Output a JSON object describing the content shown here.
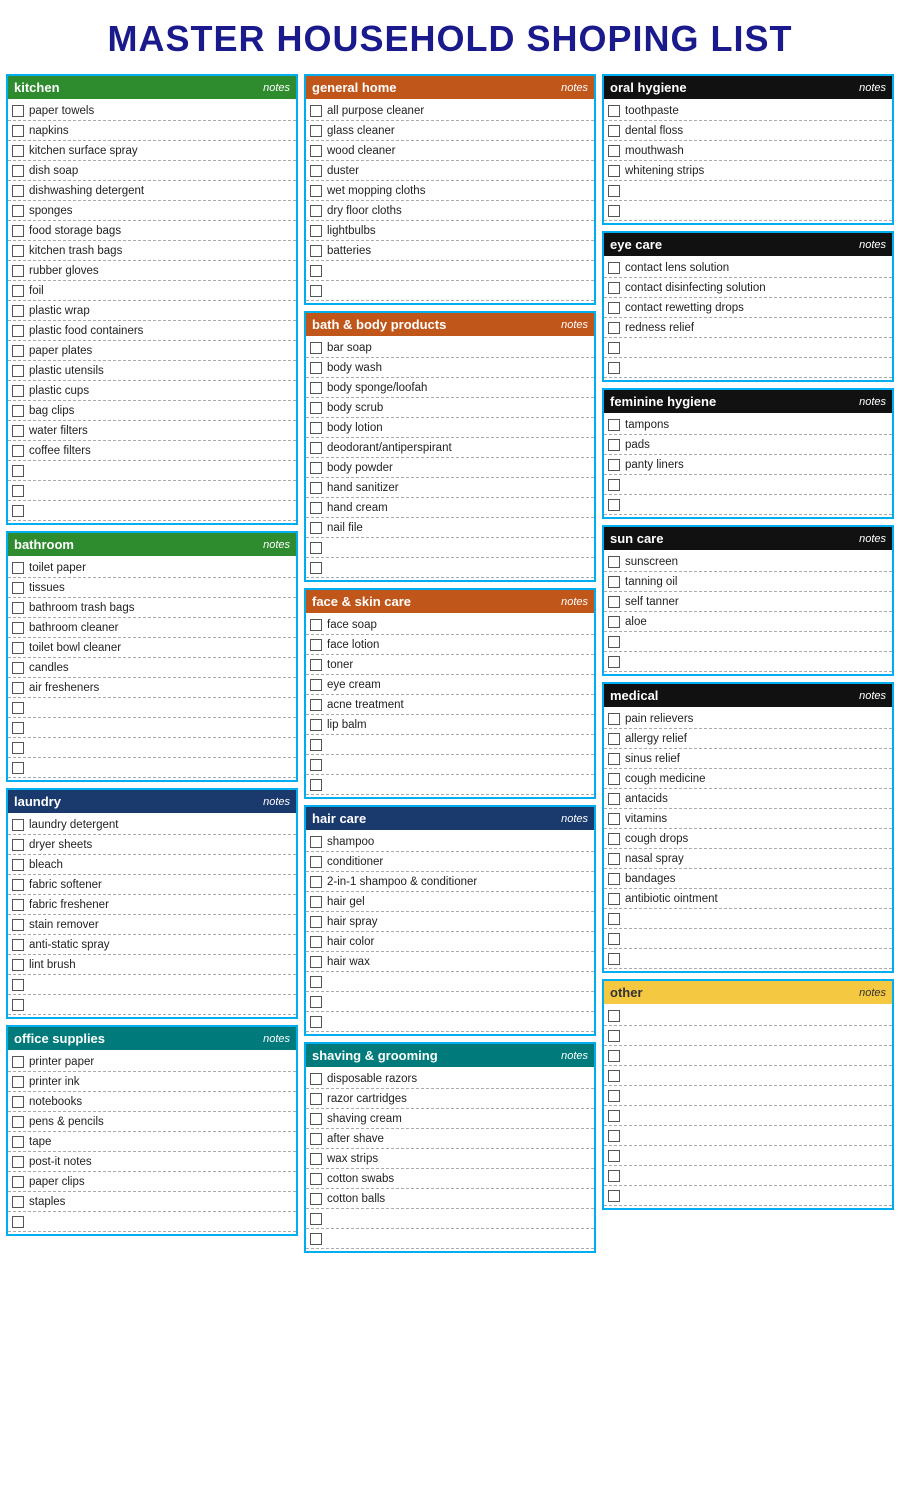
{
  "title": "MASTER HOUSEHOLD SHOPING LIST",
  "sections": {
    "kitchen": {
      "label": "kitchen",
      "headerClass": "green",
      "items": [
        "paper towels",
        "napkins",
        "kitchen surface spray",
        "dish soap",
        "dishwashing detergent",
        "sponges",
        "food storage bags",
        "kitchen trash bags",
        "rubber gloves",
        "foil",
        "plastic wrap",
        "plastic food containers",
        "paper plates",
        "plastic utensils",
        "plastic cups",
        "bag clips",
        "water filters",
        "coffee filters"
      ],
      "emptyRows": 3
    },
    "bathroom": {
      "label": "bathroom",
      "headerClass": "green",
      "items": [
        "toilet paper",
        "tissues",
        "bathroom trash bags",
        "bathroom cleaner",
        "toilet bowl cleaner",
        "candles",
        "air fresheners"
      ],
      "emptyRows": 4
    },
    "laundry": {
      "label": "laundry",
      "headerClass": "navy",
      "items": [
        "laundry detergent",
        "dryer sheets",
        "bleach",
        "fabric softener",
        "fabric freshener",
        "stain remover",
        "anti-static spray",
        "lint brush"
      ],
      "emptyRows": 2
    },
    "office_supplies": {
      "label": "office supplies",
      "headerClass": "teal",
      "items": [
        "printer paper",
        "printer ink",
        "notebooks",
        "pens & pencils",
        "tape",
        "post-it notes",
        "paper clips",
        "staples"
      ],
      "emptyRows": 1
    },
    "general_home": {
      "label": "general home",
      "headerClass": "orange",
      "items": [
        "all purpose cleaner",
        "glass cleaner",
        "wood cleaner",
        "duster",
        "wet mopping cloths",
        "dry floor cloths",
        "lightbulbs",
        "batteries"
      ],
      "emptyRows": 2
    },
    "bath_body": {
      "label": "bath & body products",
      "headerClass": "orange",
      "items": [
        "bar soap",
        "body wash",
        "body sponge/loofah",
        "body scrub",
        "body lotion",
        "deodorant/antiperspirant",
        "body powder",
        "hand sanitizer",
        "hand cream",
        "nail file"
      ],
      "emptyRows": 2
    },
    "face_skin": {
      "label": "face & skin care",
      "headerClass": "orange",
      "items": [
        "face soap",
        "face lotion",
        "toner",
        "eye cream",
        "acne treatment",
        "lip balm"
      ],
      "emptyRows": 3
    },
    "hair_care": {
      "label": "hair care",
      "headerClass": "navy",
      "items": [
        "shampoo",
        "conditioner",
        "2-in-1 shampoo & conditioner",
        "hair gel",
        "hair spray",
        "hair color",
        "hair wax"
      ],
      "emptyRows": 3
    },
    "shaving_grooming": {
      "label": "shaving & grooming",
      "headerClass": "teal",
      "items": [
        "disposable razors",
        "razor cartridges",
        "shaving cream",
        "after shave",
        "wax strips",
        "cotton swabs",
        "cotton balls"
      ],
      "emptyRows": 2
    },
    "oral_hygiene": {
      "label": "oral hygiene",
      "headerClass": "black",
      "items": [
        "toothpaste",
        "dental floss",
        "mouthwash",
        "whitening strips"
      ],
      "emptyRows": 2
    },
    "eye_care": {
      "label": "eye care",
      "headerClass": "black",
      "items": [
        "contact lens solution",
        "contact disinfecting solution",
        "contact rewetting drops",
        "redness relief"
      ],
      "emptyRows": 2
    },
    "feminine_hygiene": {
      "label": "feminine hygiene",
      "headerClass": "black",
      "items": [
        "tampons",
        "pads",
        "panty liners"
      ],
      "emptyRows": 2
    },
    "sun_care": {
      "label": "sun care",
      "headerClass": "black",
      "items": [
        "sunscreen",
        "tanning oil",
        "self tanner",
        "aloe"
      ],
      "emptyRows": 2
    },
    "medical": {
      "label": "medical",
      "headerClass": "black",
      "items": [
        "pain relievers",
        "allergy relief",
        "sinus relief",
        "cough medicine",
        "antacids",
        "vitamins",
        "cough drops",
        "nasal spray",
        "bandages",
        "antibiotic ointment"
      ],
      "emptyRows": 3
    },
    "other": {
      "label": "other",
      "headerClass": "yellow",
      "items": [],
      "emptyRows": 10
    }
  },
  "notes_label": "notes"
}
